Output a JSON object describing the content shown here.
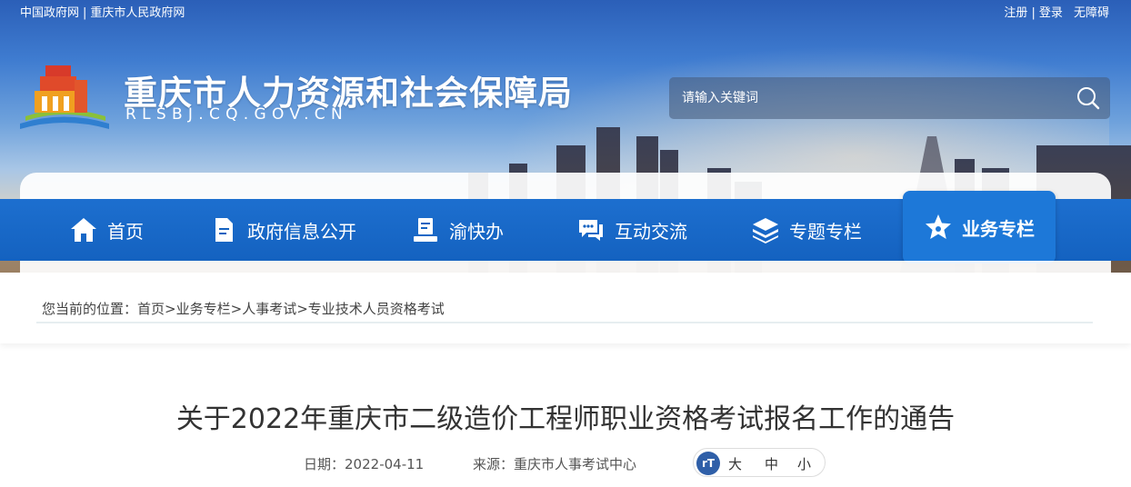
{
  "top_links": {
    "left": [
      "中国政府网",
      "重庆市人民政府网"
    ],
    "right": [
      "注册",
      "登录",
      "无障碍"
    ]
  },
  "header": {
    "title": "重庆市人力资源和社会保障局",
    "domain": "RLSBJ.CQ.GOV.CN"
  },
  "search": {
    "placeholder": "请输入关键词"
  },
  "nav": {
    "items": [
      {
        "label": "首页",
        "icon": "home-icon"
      },
      {
        "label": "政府信息公开",
        "icon": "document-icon"
      },
      {
        "label": "渝快办",
        "icon": "book-stand-icon"
      },
      {
        "label": "互动交流",
        "icon": "chat-icon"
      },
      {
        "label": "专题专栏",
        "icon": "layers-icon"
      },
      {
        "label": "业务专栏",
        "icon": "star-icon",
        "active": true
      }
    ]
  },
  "breadcrumb": {
    "prefix": "您当前的位置：",
    "items": [
      "首页",
      "业务专栏",
      "人事考试",
      "专业技术人员资格考试"
    ],
    "separator": ">"
  },
  "article": {
    "title": "关于2022年重庆市二级造价工程师职业资格考试报名工作的通告",
    "date_label": "日期：",
    "date": "2022-04-11",
    "source_label": "来源：",
    "source": "重庆市人事考试中心"
  },
  "font_size": {
    "icon_text": "rT",
    "options": [
      "大",
      "中",
      "小"
    ]
  },
  "colors": {
    "nav_bg": "#1462c0",
    "nav_active": "#1d78d8"
  }
}
